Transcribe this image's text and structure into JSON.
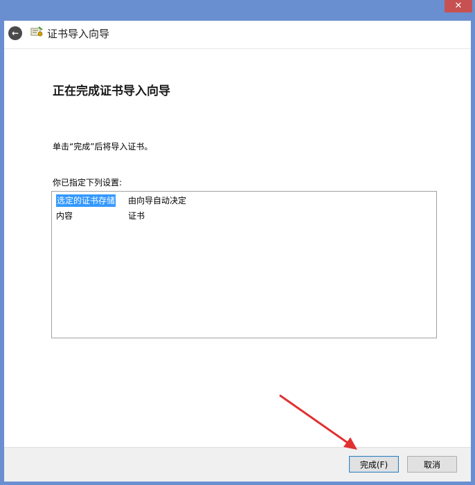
{
  "window": {
    "close_glyph": "✕"
  },
  "nav": {
    "title": "证书导入向导",
    "back_glyph": "←"
  },
  "wizard": {
    "heading": "正在完成证书导入向导",
    "instruction": "单击“完成”后将导入证书。",
    "settings_label": "你已指定下列设置:",
    "settings": [
      {
        "key": "选定的证书存储",
        "value": "由向导自动决定"
      },
      {
        "key": "内容",
        "value": "证书"
      }
    ]
  },
  "buttons": {
    "finish": "完成(F)",
    "cancel": "取消"
  },
  "colors": {
    "frame": "#6a8fd0",
    "close": "#c75050",
    "selection": "#3399ff",
    "arrow": "#e03030"
  }
}
